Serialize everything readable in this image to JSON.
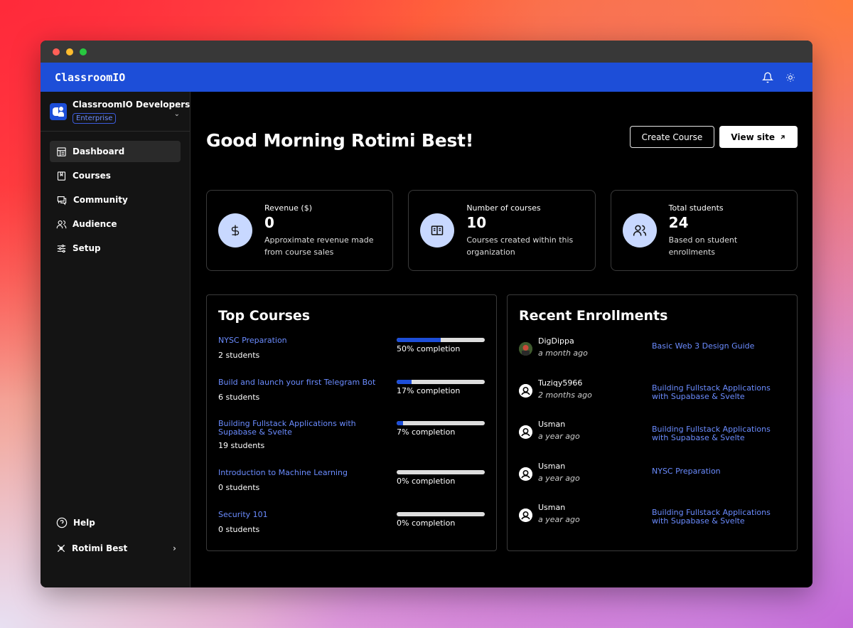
{
  "app": {
    "brand": "ClassroomIO"
  },
  "org": {
    "name": "ClassroomIO Developers",
    "badge": "Enterprise"
  },
  "nav": [
    {
      "label": "Dashboard",
      "icon": "dashboard-icon",
      "active": true
    },
    {
      "label": "Courses",
      "icon": "book-icon"
    },
    {
      "label": "Community",
      "icon": "chat-icon"
    },
    {
      "label": "Audience",
      "icon": "users-icon"
    },
    {
      "label": "Setup",
      "icon": "sliders-icon"
    }
  ],
  "sidebar_bottom": {
    "help": "Help",
    "user": "Rotimi Best"
  },
  "header": {
    "greeting": "Good Morning Rotimi Best!",
    "create_course": "Create Course",
    "view_site": "View site"
  },
  "stats": [
    {
      "label": "Revenue ($)",
      "value": "0",
      "desc": "Approximate revenue made from course sales",
      "icon": "dollar-icon"
    },
    {
      "label": "Number of courses",
      "value": "10",
      "desc": "Courses created within this organization",
      "icon": "open-book-icon"
    },
    {
      "label": "Total students",
      "value": "24",
      "desc": "Based on student enrollments",
      "icon": "users-icon"
    }
  ],
  "top_courses": {
    "title": "Top Courses",
    "items": [
      {
        "name": "NYSC Preparation",
        "students": "2 students",
        "completion": "50% completion",
        "percent": 50
      },
      {
        "name": "Build and launch your first Telegram Bot",
        "students": "6 students",
        "completion": "17% completion",
        "percent": 17
      },
      {
        "name": "Building Fullstack Applications with Supabase & Svelte",
        "students": "19 students",
        "completion": "7% completion",
        "percent": 7
      },
      {
        "name": "Introduction to Machine Learning",
        "students": "0 students",
        "completion": "0% completion",
        "percent": 0
      },
      {
        "name": "Security 101",
        "students": "0 students",
        "completion": "0% completion",
        "percent": 0
      }
    ]
  },
  "recent_enrollments": {
    "title": "Recent Enrollments",
    "items": [
      {
        "user": "DigDippa",
        "time": "a month ago",
        "course": "Basic Web 3 Design Guide",
        "avatar": "photo"
      },
      {
        "user": "Tuziqy5966",
        "time": "2 months ago",
        "course": "Building Fullstack Applications with Supabase & Svelte",
        "avatar": "default"
      },
      {
        "user": "Usman",
        "time": "a year ago",
        "course": "Building Fullstack Applications with Supabase & Svelte",
        "avatar": "default"
      },
      {
        "user": "Usman",
        "time": "a year ago",
        "course": "NYSC Preparation",
        "avatar": "default"
      },
      {
        "user": "Usman",
        "time": "a year ago",
        "course": "Building Fullstack Applications with Supabase & Svelte",
        "avatar": "default"
      }
    ]
  },
  "colors": {
    "accent": "#1d4ed8",
    "link": "#6b8cff",
    "icon_bg": "#c8d8ff"
  }
}
